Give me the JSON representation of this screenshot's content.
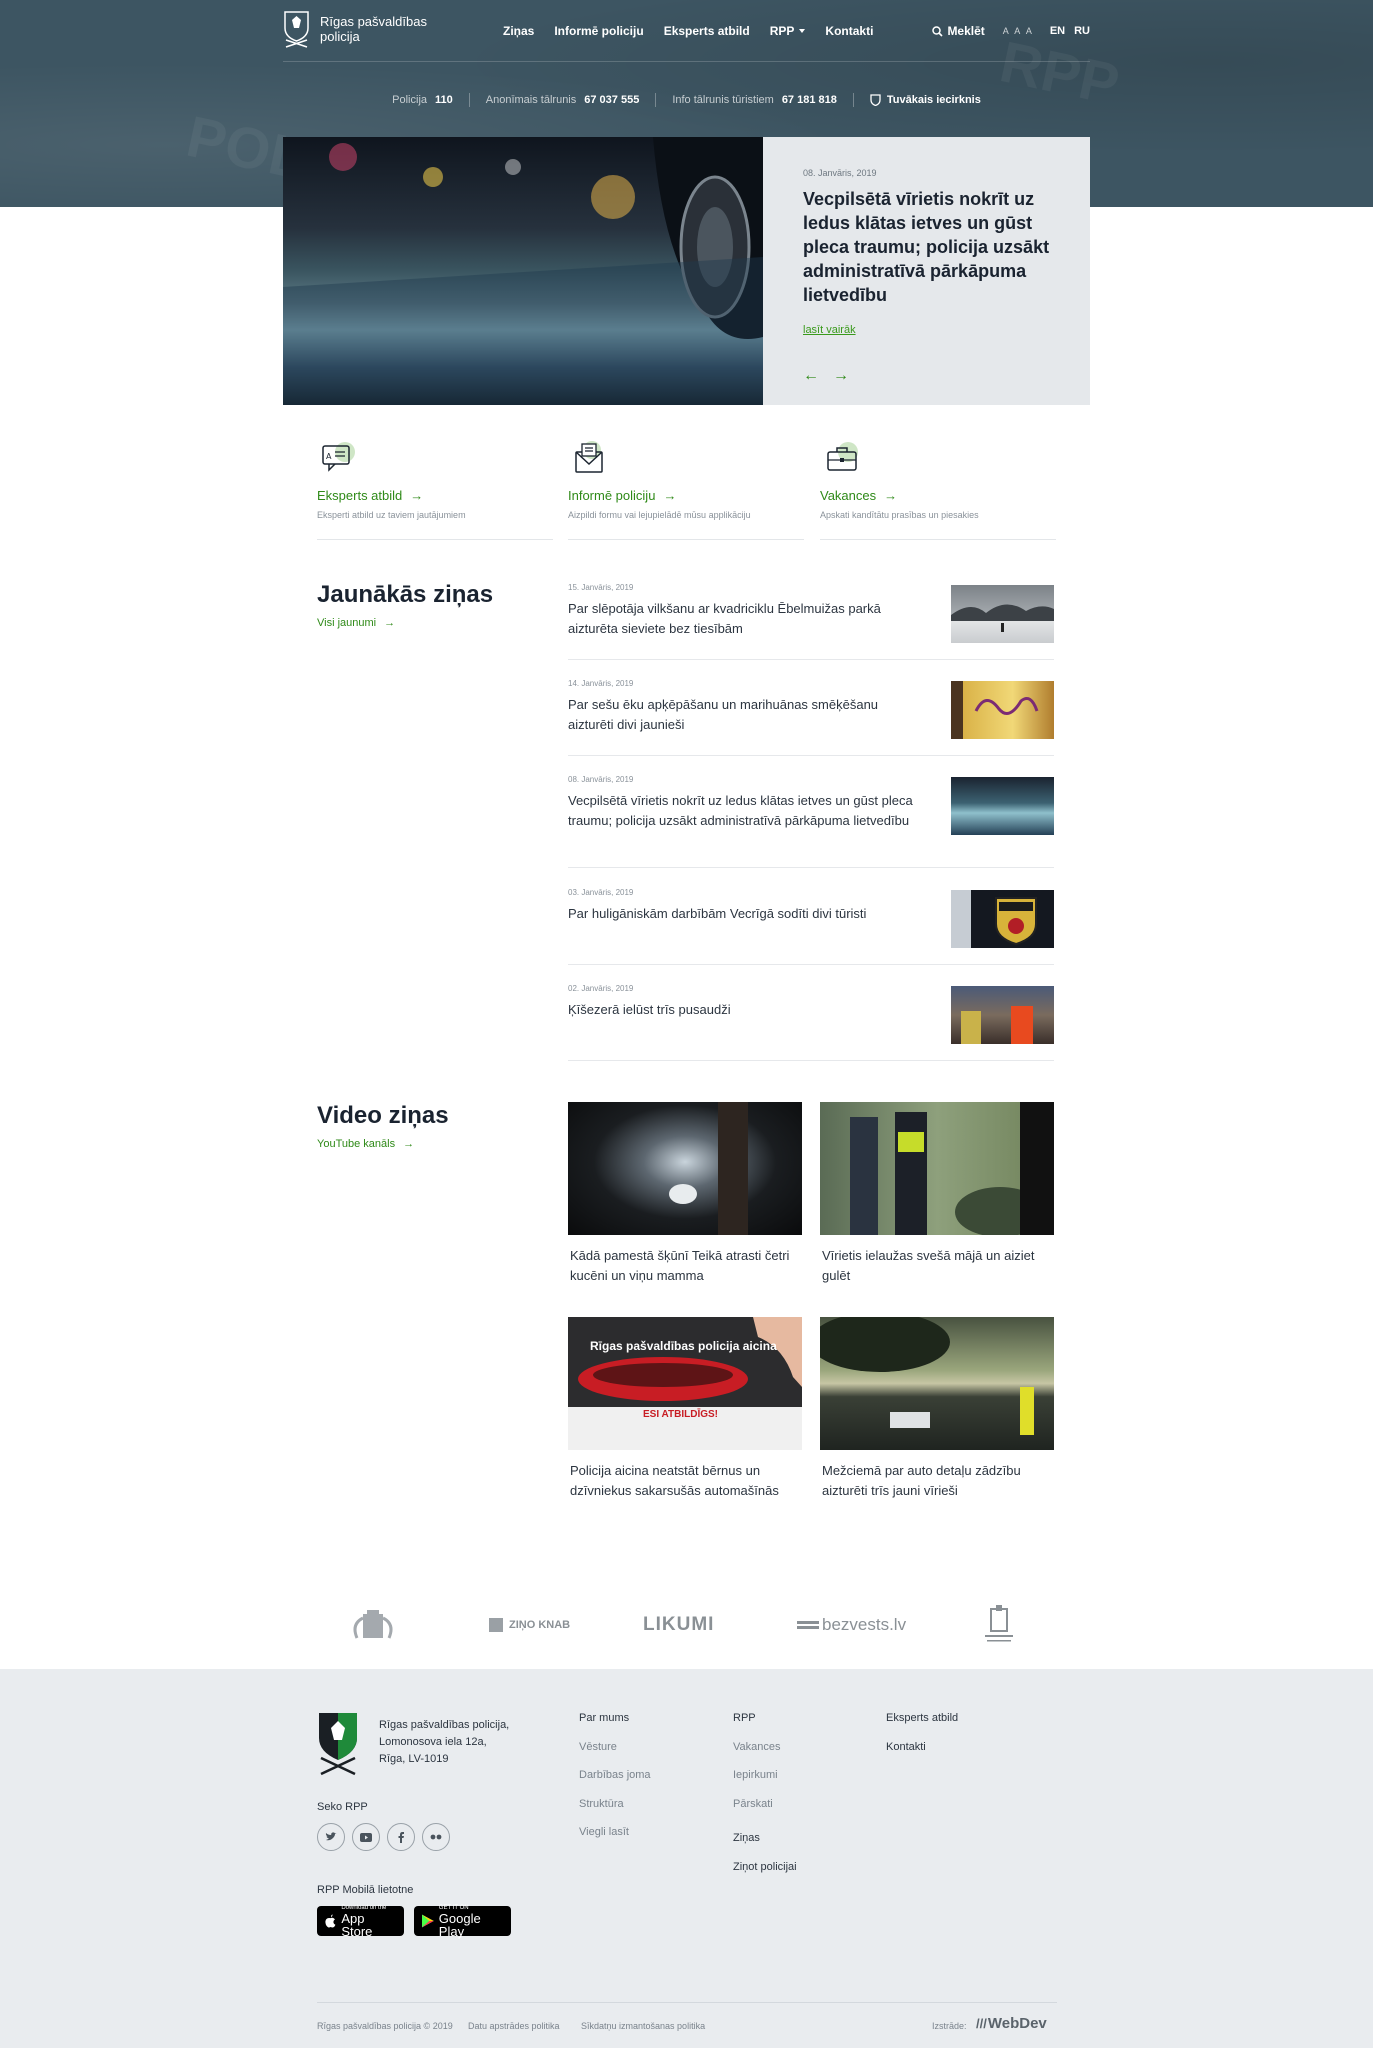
{
  "header": {
    "logo_text": "Rīgas pašvaldības policija",
    "menu": [
      "Ziņas",
      "Informē policiju",
      "Eksperts atbild",
      "RPP",
      "Kontakti"
    ],
    "search_label": "Meklēt",
    "font_size_label": "A A A",
    "languages": [
      "EN",
      "RU"
    ],
    "info": [
      {
        "label": "Policija",
        "value": "110"
      },
      {
        "label": "Anonīmais tālrunis",
        "value": "67 037 555"
      },
      {
        "label": "Info tālrunis tūristiem",
        "value": "67 181 818"
      }
    ],
    "nearest_label": "Tuvākais iecirknis"
  },
  "hero": {
    "date": "08. Janvāris, 2019",
    "title": "Vecpilsētā vīrietis nokrīt uz ledus klātas ietves un gūst pleca traumu; policija uzsākt administratīvā pārkāpuma lietvedību",
    "more": "lasīt vairāk",
    "prev": "←",
    "next": "→"
  },
  "services": [
    {
      "title": "Eksperts atbild",
      "desc": "Eksperti atbild uz taviem jautājumiem",
      "icon": "chat-icon"
    },
    {
      "title": "Informē policiju",
      "desc": "Aizpildi formu vai lejupielādē mūsu applikāciju",
      "icon": "mail-icon"
    },
    {
      "title": "Vakances",
      "desc": "Apskati kandītātu prasības un piesakies",
      "icon": "briefcase-icon"
    }
  ],
  "news_section": {
    "title": "Jaunākās ziņas",
    "link": "Visi jaunumi",
    "items": [
      {
        "date": "15. Janvāris, 2019",
        "title": "Par slēpotāja vilkšanu ar kvadriciklu Ēbelmuižas parkā aizturēta sieviete bez tiesībām"
      },
      {
        "date": "14. Janvāris, 2019",
        "title": "Par sešu ēku apķēpāšanu un marihuānas smēķēšanu aizturēti divi jaunieši"
      },
      {
        "date": "08. Janvāris, 2019",
        "title": "Vecpilsētā vīrietis nokrīt uz ledus klātas ietves un gūst pleca traumu; policija uzsākt administratīvā pārkāpuma lietvedību"
      },
      {
        "date": "03. Janvāris, 2019",
        "title": "Par huligāniskām darbībām Vecrīgā sodīti divi tūristi"
      },
      {
        "date": "02. Janvāris, 2019",
        "title": "Ķīšezerā ielūst trīs pusaudži"
      }
    ]
  },
  "video_section": {
    "title": "Video ziņas",
    "link": "YouTube kanāls",
    "items": [
      {
        "title": "Kādā pamestā šķūnī Teikā atrasti četri kucēni un viņu mamma"
      },
      {
        "title": "Vīrietis ielaužas svešā mājā un aiziet gulēt"
      },
      {
        "title": "Policija aicina neatstāt bērnus un dzīvniekus sakarsušās automašīnās",
        "overlay_top": "Rīgas pašvaldības policija aicina",
        "overlay_bottom": "ESI ATBILDĪGS!"
      },
      {
        "title": "Mežciemā par auto detaļu zādzību aizturēti trīs jauni vīrieši"
      }
    ]
  },
  "partners": [
    "ZIŅO KNAB",
    "LIKUMI",
    "bezvests.lv"
  ],
  "footer": {
    "address": [
      "Rīgas pašvaldības policija,",
      "Lomonosova iela 12a,",
      "Rīga, LV-1019"
    ],
    "follow": "Seko RPP",
    "app": "RPP Mobilā lietotne",
    "appstore_small": "Download on the",
    "appstore_big": "App Store",
    "googleplay_small": "GET IT ON",
    "googleplay_big": "Google Play",
    "col1": [
      "Par mums",
      "Vēsture",
      "Darbības joma",
      "Struktūra",
      "Viegli lasīt"
    ],
    "col2": [
      "RPP",
      "Vakances",
      "Iepirkumi",
      "Pārskati"
    ],
    "col2b": [
      "Ziņas",
      "Ziņot policijai"
    ],
    "col3": [
      "Eksperts atbild",
      "Kontakti"
    ],
    "copyright": "Rīgas pašvaldības policija © 2019",
    "privacy": "Datu apstrādes politika",
    "cookies": "Sīkdatņu izmantošanas politika",
    "made_by": "Izstrāde:",
    "made_by_brand": "WebDev"
  },
  "colors": {
    "accent": "#2f8a18",
    "header_bg": "#3d5562",
    "footer_bg": "#e9ecef"
  }
}
